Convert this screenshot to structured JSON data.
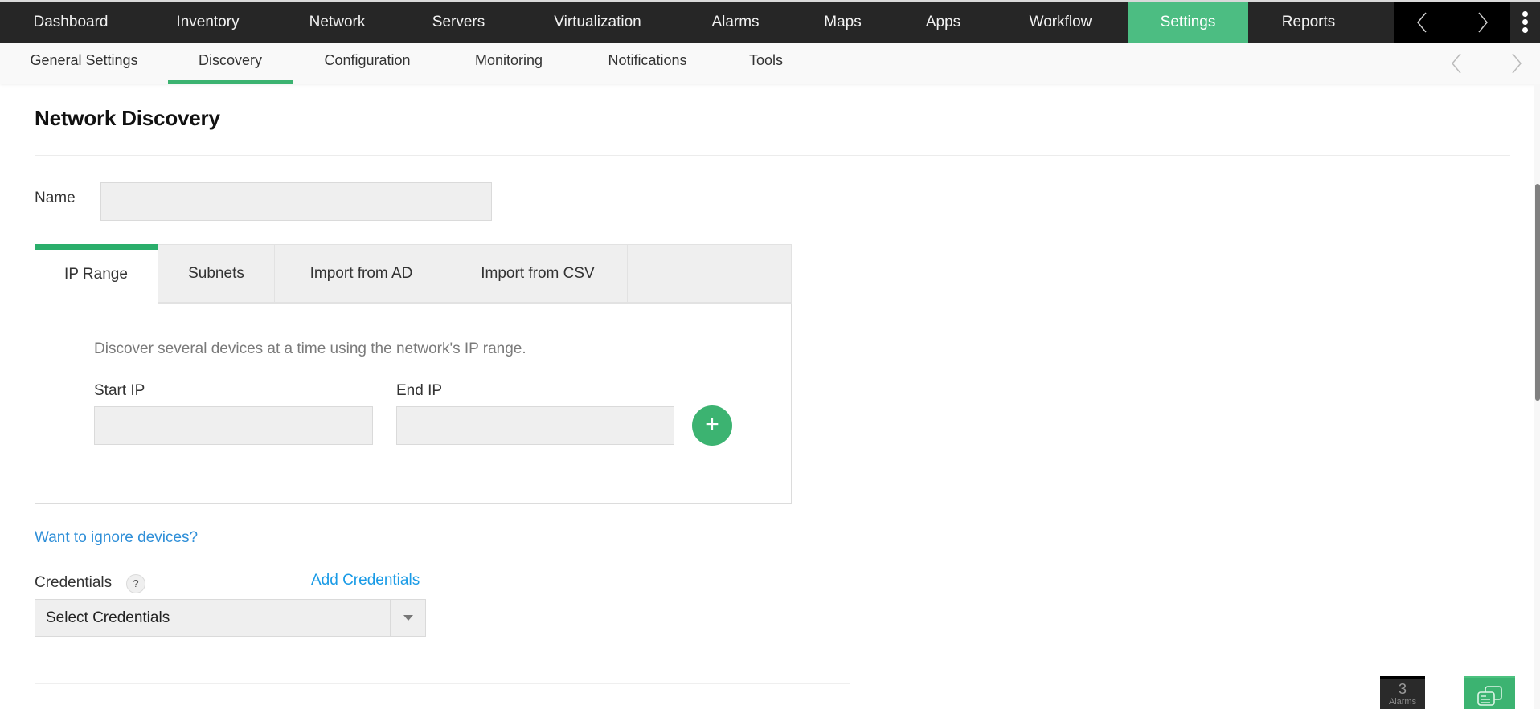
{
  "top_nav": {
    "items": [
      {
        "label": "Dashboard",
        "active": false
      },
      {
        "label": "Inventory",
        "active": false
      },
      {
        "label": "Network",
        "active": false
      },
      {
        "label": "Servers",
        "active": false
      },
      {
        "label": "Virtualization",
        "active": false
      },
      {
        "label": "Alarms",
        "active": false
      },
      {
        "label": "Maps",
        "active": false
      },
      {
        "label": "Apps",
        "active": false
      },
      {
        "label": "Workflow",
        "active": false
      },
      {
        "label": "Settings",
        "active": true
      },
      {
        "label": "Reports",
        "active": false
      }
    ],
    "scroll_left_icon": "chevron-left-icon",
    "scroll_right_icon": "chevron-right-icon",
    "more_icon": "kebab-menu-icon"
  },
  "sub_nav": {
    "items": [
      {
        "label": "General Settings",
        "active": false
      },
      {
        "label": "Discovery",
        "active": true
      },
      {
        "label": "Configuration",
        "active": false
      },
      {
        "label": "Monitoring",
        "active": false
      },
      {
        "label": "Notifications",
        "active": false
      },
      {
        "label": "Tools",
        "active": false
      }
    ]
  },
  "page": {
    "title": "Network Discovery",
    "name_label": "Name",
    "name_value": "",
    "tabs": [
      {
        "label": "IP Range",
        "active": true
      },
      {
        "label": "Subnets",
        "active": false
      },
      {
        "label": "Import from AD",
        "active": false
      },
      {
        "label": "Import from CSV",
        "active": false
      }
    ],
    "ip_range": {
      "description": "Discover several devices at a time using the network's IP range.",
      "start_ip_label": "Start IP",
      "start_ip_value": "",
      "end_ip_label": "End IP",
      "end_ip_value": "",
      "add_button_label": "+"
    },
    "ignore_devices_link": "Want to ignore devices?",
    "credentials_label": "Credentials",
    "credentials_help": "?",
    "add_credentials_link": "Add Credentials",
    "credentials_select_value": "Select Credentials"
  },
  "footer_widgets": {
    "alarms_count": "3",
    "alarms_label": "Alarms",
    "chat_icon": "chat-bubbles-icon"
  },
  "colors": {
    "accent_green": "#4cbd82",
    "button_green": "#3cb371",
    "topbar_bg": "#262626",
    "link_blue": "#2f8fd8"
  }
}
